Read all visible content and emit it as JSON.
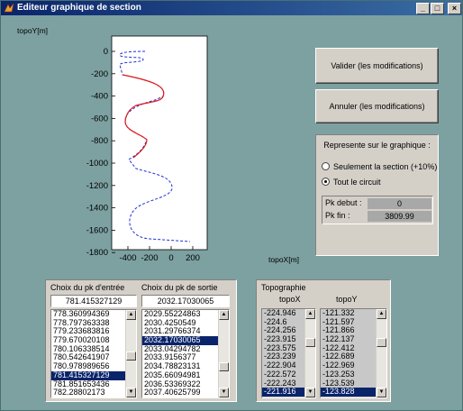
{
  "window": {
    "title": "Editeur graphique de section"
  },
  "plot": {
    "ylabel": "topoY[m]",
    "xlabel": "topoX[m]",
    "y_ticks": [
      "0",
      "-200",
      "-400",
      "-600",
      "-800",
      "-1000",
      "-1200",
      "-1400",
      "-1600",
      "-1800"
    ],
    "x_ticks": [
      "-400",
      "-200",
      "0",
      "200"
    ],
    "colors": {
      "section": "#e01818",
      "circuit": "#1e2ed8"
    }
  },
  "buttons": {
    "validate": "Valider (les modifications)",
    "cancel": "Annuler (les modifications)"
  },
  "display_panel": {
    "title": "Represente sur le graphique :",
    "option_section": "Seulement la section (+10%)",
    "option_circuit": "Tout le circuit",
    "selected": "circuit",
    "pk_debut_label": "Pk debut  :",
    "pk_debut_value": "0",
    "pk_fin_label": "Pk     fin   :",
    "pk_fin_value": "3809.99"
  },
  "pk_panel": {
    "entry_label": "Choix du pk d'entrée",
    "exit_label": "Choix du pk de sortie",
    "entry_value": "781.415327129",
    "exit_value": "2032.17030065",
    "entry_list": [
      "778.360994369",
      "778.797363338",
      "779.233683816",
      "779.670020108",
      "780.106338514",
      "780.542641907",
      "780.978989656",
      "781.415327129",
      "781.851653436",
      "782.28802173"
    ],
    "entry_selected": 7,
    "exit_list": [
      "2029.55224863",
      "2030.4250549",
      "2031.29766374",
      "2032.17030065",
      "2033.04294782",
      "2033.9156377",
      "2034.78823131",
      "2035.66094981",
      "2036.53369322",
      "2037.40625799"
    ],
    "exit_selected": 3
  },
  "topo_panel": {
    "title": "Topographie",
    "col_x": "topoX",
    "col_y": "topoY",
    "x_list": [
      "-224.946",
      "-224.6",
      "-224.256",
      "-223.915",
      "-223.575",
      "-223.239",
      "-222.904",
      "-222.572",
      "-222.243",
      "-221.916"
    ],
    "y_list": [
      "-121.332",
      "-121.597",
      "-121.866",
      "-122.137",
      "-122.412",
      "-122.689",
      "-122.969",
      "-123.253",
      "-123.539",
      "-123.828"
    ],
    "selected": 9
  }
}
